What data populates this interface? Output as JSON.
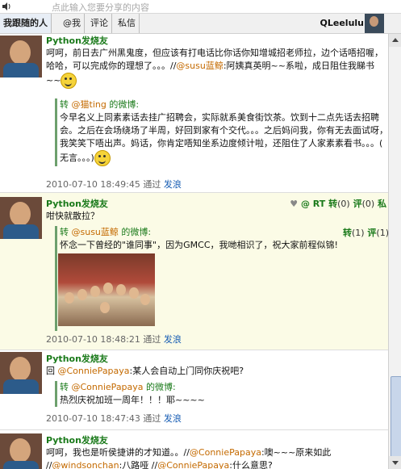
{
  "search": {
    "placeholder": "点此输入您要分享的内容"
  },
  "tabs": [
    "我跟随的人",
    "@我",
    "评论",
    "私信"
  ],
  "user": {
    "name": "QLeelulu"
  },
  "posts": [
    {
      "author": "Python发烧友",
      "text_a": "呵呵，前日去广州黑鬼度，但应该有打电话比你话你知增城招老师拉，边个话唔招喔，哈哈，可以完成你的理想了。。。//",
      "mention": "@susu蓝鲸",
      "text_b": ":阿姨真英明~~系啦，成日阻住我睇书~~",
      "rt_user": "@猫ting",
      "rt_suffix": " 的微博:",
      "rt_prefix": "转 ",
      "rt_text": "今早名义上同素素话去挂广招聘会，实际就系美食街饮茶。饮到十二点先话去招聘会。之后在会场绕场了半周，好回到家有个交代。。。之后妈问我，你有无去面试呀，我笑笑下唔出声。妈话，你肯定唔知坐系边度倾计啦，还阻住了人家素素看书。。。( 无言。。。)",
      "time": "2010-07-10 18:49:45",
      "via": "通过",
      "source": "发浪"
    },
    {
      "author": "Python发烧友",
      "actions": {
        "fav": "♥",
        "at": "@",
        "rt": "RT",
        "repost": "转",
        "repost_count": "(0)",
        "comment": "评",
        "comment_count": "(0)",
        "dm": "私"
      },
      "text": "咁快就散拉？",
      "rt_prefix": "转 ",
      "rt_user": "@susu蓝鲸",
      "rt_suffix": " 的微博:",
      "rt_actions": {
        "repost": "转",
        "repost_count": "(1)",
        "comment": "评",
        "comment_count": "(1)"
      },
      "rt_text": "怀念一下曾经的\"谁同事\"，因为GMCC，我哋相识了，祝大家前程似锦!",
      "time": "2010-07-10 18:48:21",
      "via": "通过",
      "source": "发浪"
    },
    {
      "author": "Python发烧友",
      "reply": "回 ",
      "mention": "@ConniePapaya",
      "text": ":某人会自动上门同你庆祝吧?",
      "rt_prefix": "转 ",
      "rt_user": "@ConniePapaya",
      "rt_suffix": " 的微博:",
      "rt_text": "热烈庆祝加班一周年！！！耶~~~~",
      "time": "2010-07-10 18:47:43",
      "via": "通过",
      "source": "发浪"
    },
    {
      "author": "Python发烧友",
      "text_a": "呵呵，我也是听侯捷讲的才知道。。//",
      "mention1": "@ConniePapaya",
      "text_b": ":噢~~~原来如此",
      "line2_a": "//",
      "mention2": "@windsonchan",
      "line2_b": ":八路哑 //",
      "mention3": "@ConniePapaya",
      "line2_c": ":什么意思?"
    }
  ],
  "colors": {
    "author": "#1a7a1a",
    "mention": "#c46a00",
    "link": "#1a5fb4",
    "highlight": "#fbfbe6"
  },
  "icons": [
    "speaker-icon",
    "smile-emoji-icon",
    "sweat-emoji-icon",
    "heart-icon",
    "scroll-up-icon",
    "scroll-down-icon"
  ]
}
